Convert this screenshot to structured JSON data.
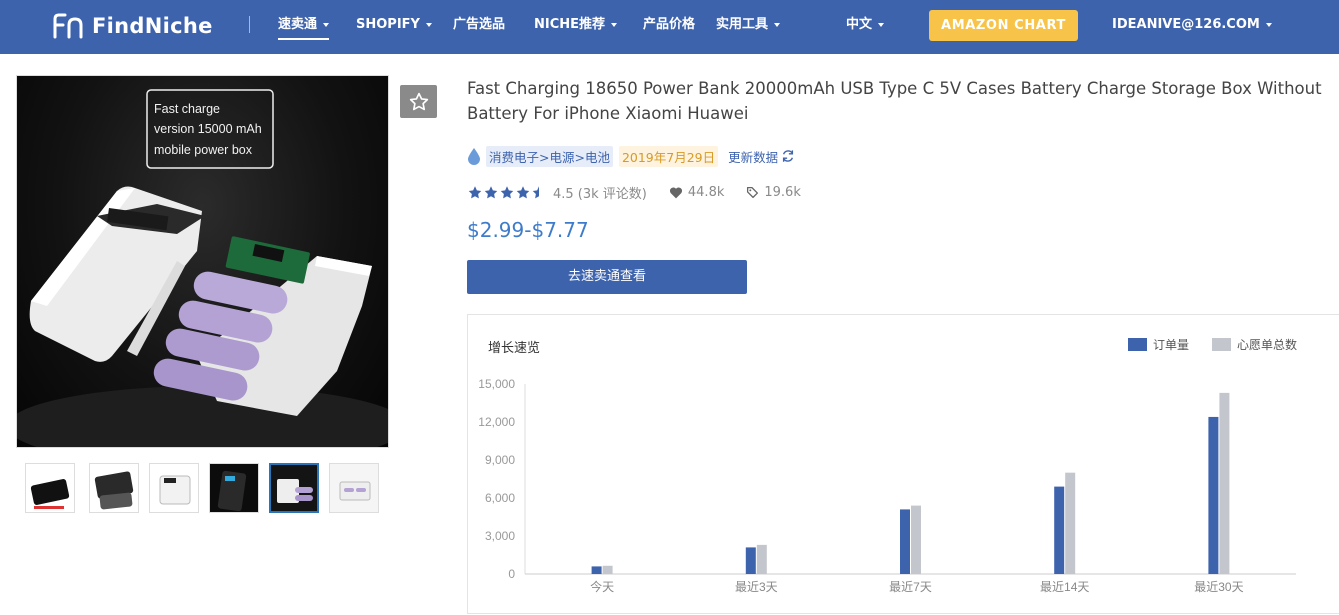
{
  "nav": {
    "logo_text": "FindNiche",
    "items": [
      {
        "label": "速卖通",
        "caret": true
      },
      {
        "label": "SHOPIFY",
        "caret": true
      },
      {
        "label": "广告选品",
        "caret": false
      },
      {
        "label": "NICHE推荐",
        "caret": true
      },
      {
        "label": "产品价格",
        "caret": false
      },
      {
        "label": "实用工具",
        "caret": true
      }
    ],
    "language": "中文",
    "amazon_chart": "AMAZON CHART",
    "user_email": "IDEANIVE@126.COM",
    "colors": {
      "bar": "#3e63ad",
      "accent_button": "#f8c349"
    }
  },
  "product": {
    "image_caption_lines": [
      "Fast charge",
      "version 15000 mAh",
      "mobile power box"
    ],
    "thumbnail_count": 6,
    "active_thumbnail": 5,
    "title": "Fast Charging 18650 Power Bank 20000mAh USB Type C 5V Cases Battery Charge Storage Box Without Battery For iPhone Xiaomi Huawei",
    "category_path": "消费电子>电源>电池",
    "date": "2019年7月29日",
    "refresh_label": "更新数据",
    "rating": 4.5,
    "rating_text": "4.5 (3k 评论数)",
    "wishlist_count": "44.8k",
    "orders_count": "19.6k",
    "price": "$2.99-$7.77",
    "cta_label": "去速卖通查看"
  },
  "chart_data": {
    "type": "bar",
    "title": "增长速览",
    "categories": [
      "今天",
      "最近3天",
      "最近7天",
      "最近14天",
      "最近30天"
    ],
    "series": [
      {
        "name": "订单量",
        "color": "#3e63ad",
        "values": [
          600,
          2100,
          5100,
          6900,
          12400
        ]
      },
      {
        "name": "心愿单总数",
        "color": "#c3c6cc",
        "values": [
          650,
          2300,
          5400,
          8000,
          14300
        ]
      }
    ],
    "yticks": [
      "0",
      "3,000",
      "6,000",
      "9,000",
      "12,000",
      "15,000"
    ],
    "ylim": [
      0,
      15000
    ],
    "legend_position": "top-right"
  }
}
